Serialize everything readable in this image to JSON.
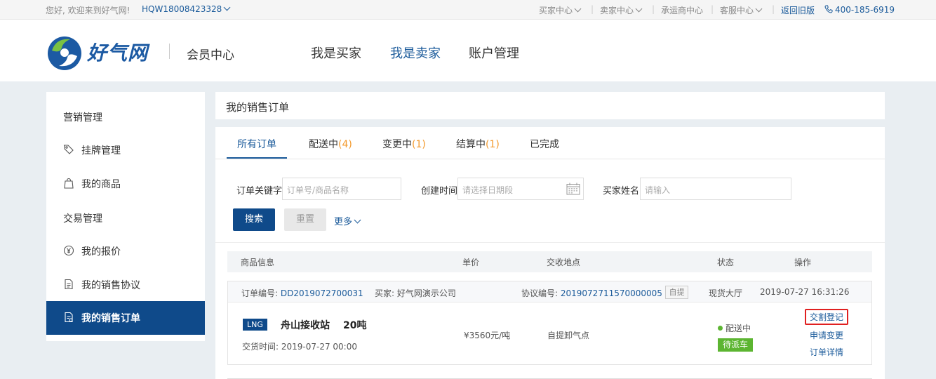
{
  "topbar": {
    "welcome": "您好, 欢迎来到好气网!",
    "user": "HQW18008423328",
    "links": [
      "买家中心",
      "卖家中心",
      "承运商中心",
      "客服中心"
    ],
    "back_old": "返回旧版",
    "phone": "400-185-6919"
  },
  "header": {
    "logo_text": "好气网",
    "member_center": "会员中心",
    "nav": [
      "我是买家",
      "我是卖家",
      "账户管理"
    ],
    "active_nav": "我是卖家"
  },
  "sidebar": {
    "group1": "营销管理",
    "items1": [
      "挂牌管理",
      "我的商品"
    ],
    "group2": "交易管理",
    "items2": [
      "我的报价",
      "我的销售协议",
      "我的销售订单"
    ]
  },
  "page_title": "我的销售订单",
  "tabs": [
    {
      "label": "所有订单",
      "count": ""
    },
    {
      "label": "配送中",
      "count": "(4)"
    },
    {
      "label": "变更中",
      "count": "(1)"
    },
    {
      "label": "结算中",
      "count": "(1)"
    },
    {
      "label": "已完成",
      "count": ""
    }
  ],
  "filters": {
    "keyword_label": "订单关键字",
    "keyword_placeholder": "订单号/商品名称",
    "date_label": "创建时间",
    "date_placeholder": "请选择日期段",
    "buyer_label": "买家姓名",
    "buyer_placeholder": "请输入",
    "search": "搜索",
    "reset": "重置",
    "more": "更多"
  },
  "table": {
    "headers": [
      "商品信息",
      "单价",
      "交收地点",
      "状态",
      "操作"
    ]
  },
  "order": {
    "order_no_label": "订单编号:",
    "order_no": "DD2019072700031",
    "buyer_label": "买家:",
    "buyer": "好气网演示公司",
    "agreement_label": "协议编号:",
    "agreement_no": "2019072711570000005",
    "pickup_tag": "自提",
    "hall": "现货大厅",
    "created": "2019-07-27 16:31:26",
    "product_tag": "LNG",
    "product_name": "舟山接收站",
    "quantity": "20吨",
    "delivery_time": "交货时间: 2019-07-27 00:00",
    "price": "¥3560元/吨",
    "place": "自提卸气点",
    "status": "配送中",
    "status_badge": "待派车",
    "actions": [
      "交割登记",
      "申请变更",
      "订单详情"
    ]
  },
  "colors": {
    "brand": "#0f4a8a",
    "count": "#f39a2d",
    "status_green": "#5cb531",
    "highlight_red": "#e02020"
  }
}
